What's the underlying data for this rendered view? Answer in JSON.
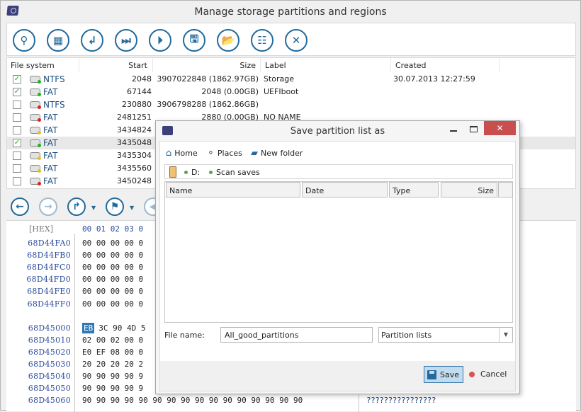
{
  "window": {
    "title": "Manage storage partitions and regions"
  },
  "toolbar": {
    "buttons": [
      {
        "name": "scan-button",
        "glyph": "⚲"
      },
      {
        "name": "regions-button",
        "glyph": "▦"
      },
      {
        "name": "insert-button",
        "glyph": "↲"
      },
      {
        "name": "skip-next-button",
        "glyph": "⏭"
      },
      {
        "name": "play-button",
        "glyph": "⏵"
      },
      {
        "name": "save-button",
        "glyph": "🖫"
      },
      {
        "name": "open-folder-button",
        "glyph": "📂"
      },
      {
        "name": "list-view-button",
        "glyph": "☷"
      },
      {
        "name": "close-button",
        "glyph": "✕"
      }
    ]
  },
  "partitions": {
    "headers": {
      "fs": "File system",
      "start": "Start",
      "size": "Size",
      "label": "Label",
      "created": "Created"
    },
    "rows": [
      {
        "checked": true,
        "status": "green",
        "fs": "NTFS",
        "start": "2048",
        "size": "3907022848 (1862.97GB)",
        "label": "Storage",
        "created": "30.07.2013 12:27:59"
      },
      {
        "checked": true,
        "status": "green",
        "fs": "FAT",
        "start": "67144",
        "size": "2048 (0.00GB)",
        "label": "UEFIboot",
        "created": ""
      },
      {
        "checked": false,
        "status": "red",
        "fs": "NTFS",
        "start": "230880",
        "size": "3906798288 (1862.86GB)",
        "label": "",
        "created": ""
      },
      {
        "checked": false,
        "status": "red",
        "fs": "FAT",
        "start": "2481251",
        "size": "2880 (0.00GB)",
        "label": "NO NAME",
        "created": ""
      },
      {
        "checked": false,
        "status": "yellow",
        "fs": "FAT",
        "start": "3434824",
        "size": "",
        "label": "",
        "created": ""
      },
      {
        "checked": true,
        "status": "green",
        "fs": "FAT",
        "start": "3435048",
        "size": "",
        "label": "",
        "created": "",
        "selected": true
      },
      {
        "checked": false,
        "status": "yellow",
        "fs": "FAT",
        "start": "3435304",
        "size": "",
        "label": "",
        "created": ""
      },
      {
        "checked": false,
        "status": "yellow",
        "fs": "FAT",
        "start": "3435560",
        "size": "",
        "label": "",
        "created": ""
      },
      {
        "checked": false,
        "status": "red",
        "fs": "FAT",
        "start": "3450248",
        "size": "",
        "label": "",
        "created": ""
      }
    ]
  },
  "status_colors": {
    "green": "#22b322",
    "red": "#e02020",
    "yellow": "#e8c020"
  },
  "hex": {
    "header_label": "[HEX]",
    "columns": "00 01 02 03 0",
    "rows": [
      {
        "addr": "68D44FA0",
        "bytes": "00 00 00 00 0"
      },
      {
        "addr": "68D44FB0",
        "bytes": "00 00 00 00 0"
      },
      {
        "addr": "68D44FC0",
        "bytes": "00 00 00 00 0"
      },
      {
        "addr": "68D44FD0",
        "bytes": "00 00 00 00 0"
      },
      {
        "addr": "68D44FE0",
        "bytes": "00 00 00 00 0"
      },
      {
        "addr": "68D44FF0",
        "bytes": "00 00 00 00 0"
      },
      {
        "addr": "68D45000",
        "bytes": "3C 90 4D 5",
        "selected_byte": "EB"
      },
      {
        "addr": "68D45010",
        "bytes": "02 00 02 00 0"
      },
      {
        "addr": "68D45020",
        "bytes": "E0 EF 08 00 0"
      },
      {
        "addr": "68D45030",
        "bytes": "20 20 20 20 2"
      },
      {
        "addr": "68D45040",
        "bytes": "90 90 90 90 9"
      },
      {
        "addr": "68D45050",
        "bytes": "90 90 90 90 9"
      },
      {
        "addr": "68D45060",
        "bytes": "90 90 90 90 90 90 90 90 90 90 90 90 90 90 90 90"
      }
    ],
    "ascii_last": "????????????????"
  },
  "dialog": {
    "title": "Save partition list as",
    "toolbar": {
      "home": "Home",
      "places": "Places",
      "new_folder": "New folder"
    },
    "path": [
      "D:",
      "Scan saves"
    ],
    "columns": [
      "Name",
      "Date",
      "Type",
      "Size"
    ],
    "file_name_label": "File name:",
    "file_name_value": "All_good_partitions",
    "file_type": "Partition lists",
    "save_label": "Save",
    "cancel_label": "Cancel"
  }
}
